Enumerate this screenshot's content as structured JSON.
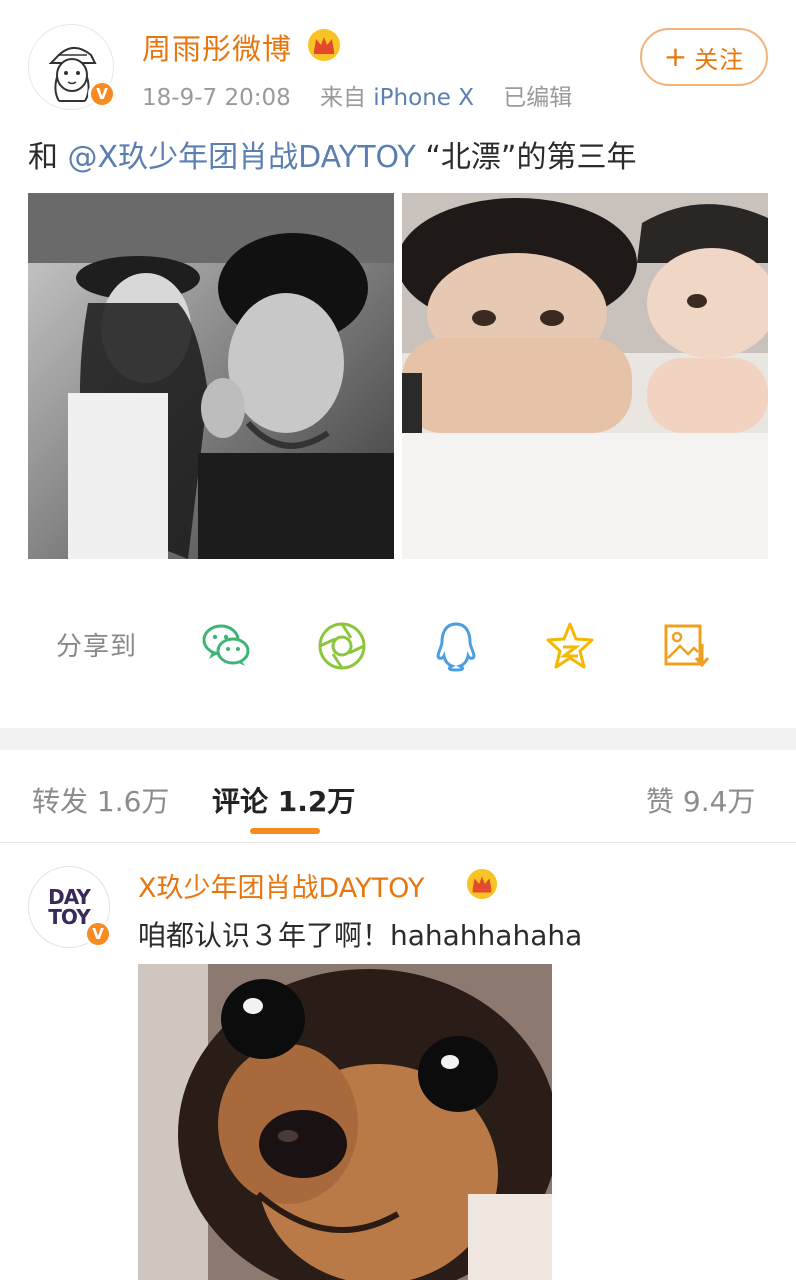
{
  "post": {
    "user_name": "周雨彤微博",
    "verified_badge": "V",
    "time": "18-9-7 20:08",
    "source_prefix": "来自",
    "source": "iPhone X",
    "edited": "已编辑",
    "follow_label": "关注",
    "follow_plus": "+",
    "text_prefix": "和 ",
    "mention": "@X玖少年团肖战DAYTOY",
    "text_suffix": " “北漂”的第三年",
    "photos": [
      "photo-selfie-bw",
      "photo-selfie-table"
    ]
  },
  "share": {
    "label": "分享到",
    "icons": [
      "wechat-icon",
      "moments-icon",
      "qq-icon",
      "qzone-icon",
      "save-image-icon"
    ],
    "colors": {
      "wechat": "#3eb575",
      "moments": "#8cc63f",
      "qq": "#4b9fe0",
      "qzone": "#f5b800",
      "save": "#f0a020"
    }
  },
  "tabs": {
    "repost": "转发 1.6万",
    "comments": "评论 1.2万",
    "likes": "赞 9.4万",
    "active": "comments"
  },
  "comment": {
    "user_name": "X玖少年团肖战DAYTOY",
    "avatar_text_1": "DAY",
    "avatar_text_2": "TOY",
    "verified_badge": "V",
    "text": "咱都认识３年了啊！hahahhahaha"
  },
  "colors": {
    "accent": "#e8760f",
    "link": "#5a7fb0",
    "badge": "#f78b21"
  }
}
